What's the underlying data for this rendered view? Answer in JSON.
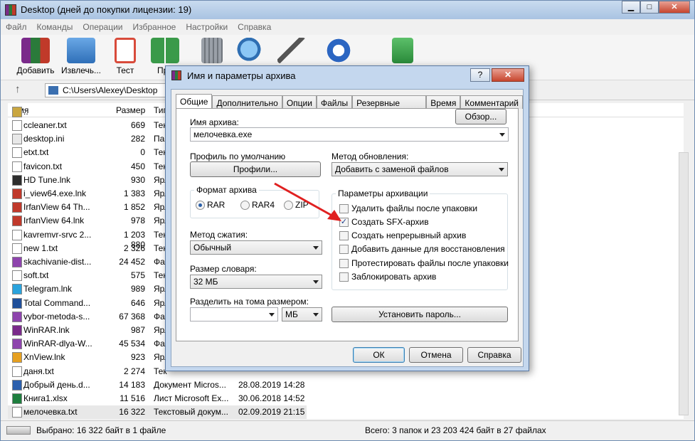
{
  "window": {
    "title": "Desktop (дней до покупки лицензии: 19)",
    "min": "▁",
    "max": "□",
    "close": "✕"
  },
  "menu": [
    "Файл",
    "Команды",
    "Операции",
    "Избранное",
    "Настройки",
    "Справка"
  ],
  "toolbar": [
    {
      "label": "Добавить",
      "icon": "add-archive-icon",
      "color": "#b33a8a"
    },
    {
      "label": "Извлечь...",
      "icon": "extract-folder-icon",
      "color": "#3b7fc9"
    },
    {
      "label": "Тест",
      "icon": "test-clipboard-icon",
      "color": "#d84b3b"
    },
    {
      "label": "Про",
      "icon": "view-book-icon",
      "color": "#3a9a4a"
    },
    {
      "label": "",
      "icon": "delete-trash-icon",
      "color": "#8a8f96"
    },
    {
      "label": "",
      "icon": "find-magnifier-icon",
      "color": "#2f6fb3"
    },
    {
      "label": "",
      "icon": "wizard-wand-icon",
      "color": "#7a9ab8"
    },
    {
      "label": "",
      "icon": "info-icon",
      "color": "#2c66c2"
    },
    {
      "label": "",
      "icon": "repair-icon",
      "color": "#3aa04a"
    }
  ],
  "address": {
    "up": "↑",
    "path": "C:\\Users\\Alexey\\Desktop"
  },
  "columns": {
    "name": "Имя",
    "size": "Размер",
    "type": "Тип"
  },
  "files": [
    {
      "name": "..",
      "size": "",
      "type": "",
      "date": "",
      "icon": "up-folder-icon"
    },
    {
      "name": "ccleaner.txt",
      "size": "669",
      "type": "Тек",
      "date": "",
      "icon": "text-file-icon"
    },
    {
      "name": "desktop.ini",
      "size": "282",
      "type": "Пар",
      "date": "",
      "icon": "ini-file-icon"
    },
    {
      "name": "etxt.txt",
      "size": "0",
      "type": "Тек",
      "date": "",
      "icon": "text-file-icon"
    },
    {
      "name": "favicon.txt",
      "size": "450",
      "type": "Тек",
      "date": "",
      "icon": "text-file-icon"
    },
    {
      "name": "HD Tune.lnk",
      "size": "930",
      "type": "Ярл",
      "date": "",
      "icon": "shortcut-icon"
    },
    {
      "name": "i_view64.exe.lnk",
      "size": "1 383",
      "type": "Ярл",
      "date": "",
      "icon": "irfanview-icon"
    },
    {
      "name": "IrfanView 64 Th...",
      "size": "1 852",
      "type": "Ярл",
      "date": "",
      "icon": "irfanview-icon"
    },
    {
      "name": "IrfanView 64.lnk",
      "size": "978",
      "type": "Ярл",
      "date": "",
      "icon": "irfanview-icon"
    },
    {
      "name": "kavremvr-srvc 2...",
      "size": "1 203 880",
      "type": "Тек",
      "date": "",
      "icon": "text-file-icon"
    },
    {
      "name": "new 1.txt",
      "size": "2 326",
      "type": "Тек",
      "date": "",
      "icon": "text-file-icon"
    },
    {
      "name": "skachivanie-dist...",
      "size": "24 452",
      "type": "Фай",
      "date": "",
      "icon": "png-file-icon"
    },
    {
      "name": "soft.txt",
      "size": "575",
      "type": "Тек",
      "date": "",
      "icon": "text-file-icon"
    },
    {
      "name": "Telegram.lnk",
      "size": "989",
      "type": "Ярл",
      "date": "",
      "icon": "telegram-icon"
    },
    {
      "name": "Total Command...",
      "size": "646",
      "type": "Ярл",
      "date": "",
      "icon": "total-commander-icon"
    },
    {
      "name": "vybor-metoda-s...",
      "size": "67 368",
      "type": "Фай",
      "date": "",
      "icon": "png-file-icon"
    },
    {
      "name": "WinRAR.lnk",
      "size": "987",
      "type": "Ярл",
      "date": "",
      "icon": "winrar-icon"
    },
    {
      "name": "WinRAR-dlya-W...",
      "size": "45 534",
      "type": "Фай",
      "date": "",
      "icon": "png-file-icon"
    },
    {
      "name": "XnView.lnk",
      "size": "923",
      "type": "Ярл",
      "date": "",
      "icon": "xnview-icon"
    },
    {
      "name": "даня.txt",
      "size": "2 274",
      "type": "Тек",
      "date": "",
      "icon": "text-file-icon"
    },
    {
      "name": "Добрый день.d...",
      "size": "14 183",
      "type": "Документ Micros...",
      "date": "28.08.2019 14:28",
      "icon": "word-doc-icon"
    },
    {
      "name": "Книга1.xlsx",
      "size": "11 516",
      "type": "Лист Microsoft Ex...",
      "date": "30.06.2018 14:52",
      "icon": "excel-icon"
    },
    {
      "name": "мелочевка.txt",
      "size": "16 322",
      "type": "Текстовый докум...",
      "date": "02.09.2019 21:15",
      "icon": "text-file-icon",
      "selected": true
    }
  ],
  "status": {
    "left": "Выбрано: 16 322 байт в 1 файле",
    "right": "Всего: 3 папок и 23 203 424 байт в 27 файлах"
  },
  "dialog": {
    "title": "Имя и параметры архива",
    "help": "?",
    "close": "✕",
    "tabs": [
      "Общие",
      "Дополнительно",
      "Опции",
      "Файлы",
      "Резервные копии",
      "Время",
      "Комментарий"
    ],
    "archive_name_label": "Имя архива:",
    "archive_name_value": "мелочевка.exe",
    "browse": "Обзор...",
    "profile_label": "Профиль по умолчанию",
    "profiles_btn": "Профили...",
    "update_label": "Метод обновления:",
    "update_value": "Добавить с заменой файлов",
    "format_label": "Формат архива",
    "formats": [
      "RAR",
      "RAR4",
      "ZIP"
    ],
    "compression_label": "Метод сжатия:",
    "compression_value": "Обычный",
    "dict_label": "Размер словаря:",
    "dict_value": "32 МБ",
    "split_label": "Разделить на тома размером:",
    "split_value": "",
    "split_unit": "МБ",
    "params_label": "Параметры архивации",
    "options": [
      {
        "label": "Удалить файлы после упаковки",
        "checked": false
      },
      {
        "label": "Создать SFX-архив",
        "checked": true
      },
      {
        "label": "Создать непрерывный архив",
        "checked": false
      },
      {
        "label": "Добавить данные для восстановления",
        "checked": false
      },
      {
        "label": "Протестировать файлы после упаковки",
        "checked": false
      },
      {
        "label": "Заблокировать архив",
        "checked": false
      }
    ],
    "password_btn": "Установить пароль...",
    "ok": "ОК",
    "cancel": "Отмена",
    "help_btn": "Справка",
    "check_mark": "✓"
  },
  "colors": {
    "accent": "#3c7fb1",
    "arrow": "#e02020"
  }
}
